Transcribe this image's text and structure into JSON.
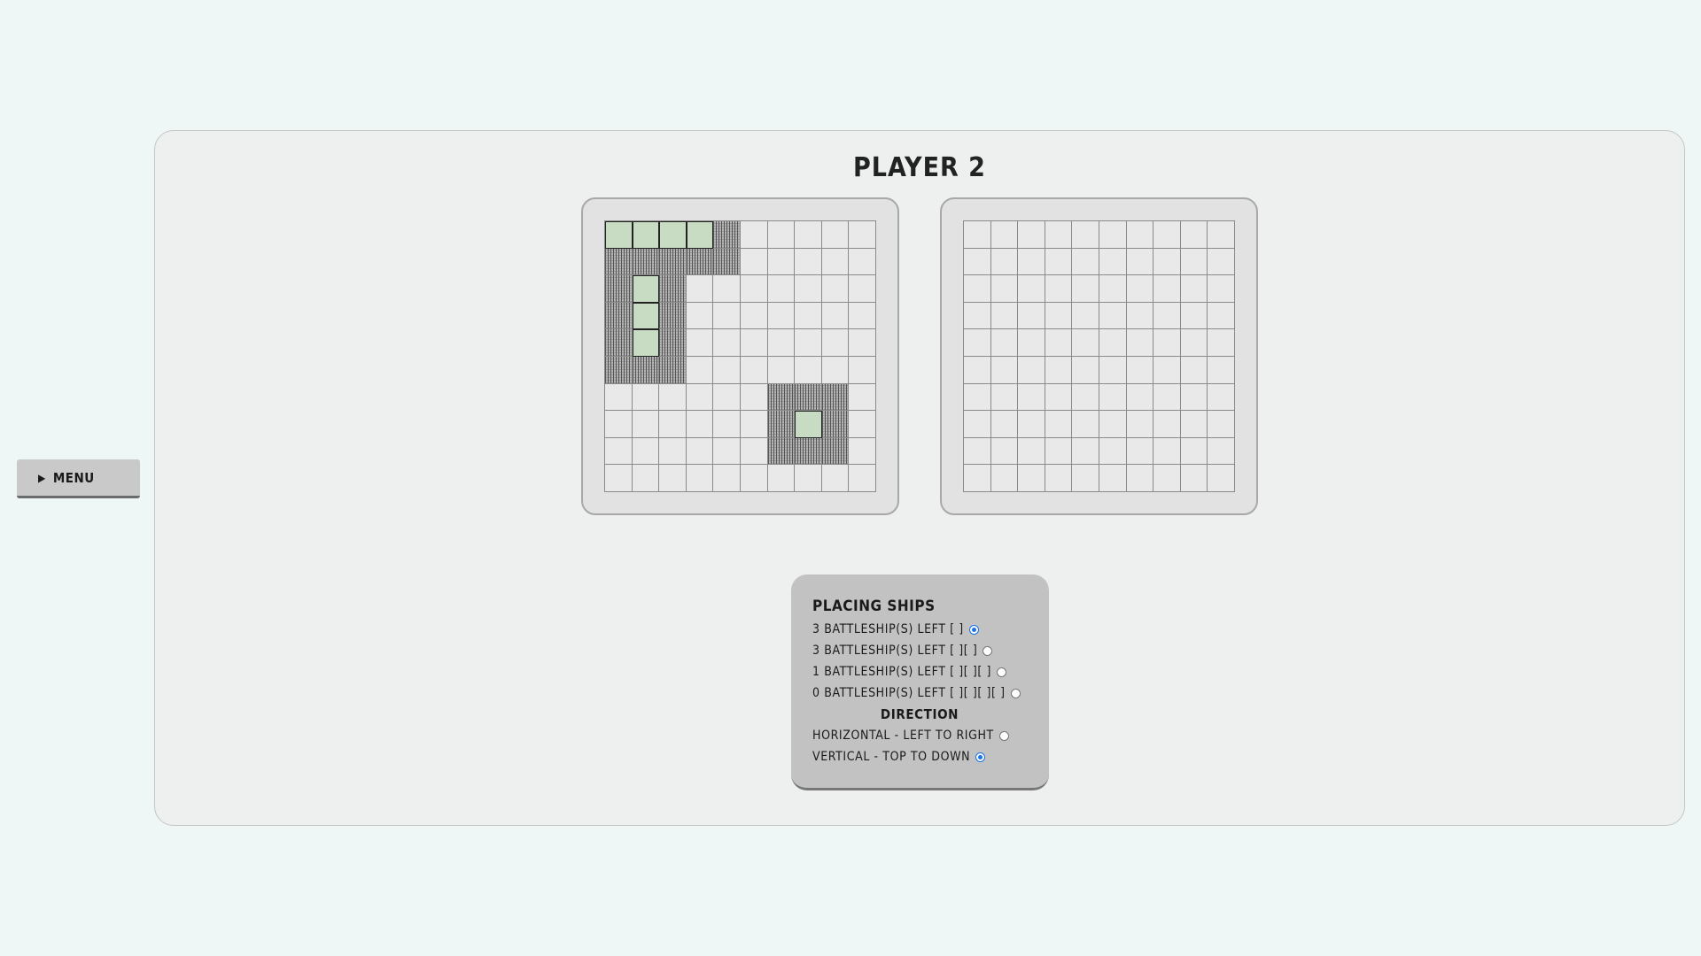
{
  "menu": {
    "label": "MENU",
    "icon": "play-triangle-icon"
  },
  "player_title": "PLAYER 2",
  "colors": {
    "ship": "#c7dcc3",
    "blocked": "#b5b5b5",
    "empty": "#e9e9e9",
    "accent": "#1a73e8"
  },
  "boards": {
    "own": {
      "ships": [
        [
          0,
          0
        ],
        [
          0,
          1
        ],
        [
          0,
          2
        ],
        [
          0,
          3
        ],
        [
          2,
          1
        ],
        [
          3,
          1
        ],
        [
          4,
          1
        ],
        [
          7,
          7
        ]
      ],
      "blocked": [
        [
          0,
          4
        ],
        [
          1,
          0
        ],
        [
          1,
          1
        ],
        [
          1,
          2
        ],
        [
          1,
          3
        ],
        [
          1,
          4
        ],
        [
          2,
          0
        ],
        [
          2,
          2
        ],
        [
          3,
          0
        ],
        [
          3,
          2
        ],
        [
          4,
          0
        ],
        [
          4,
          2
        ],
        [
          5,
          0
        ],
        [
          5,
          1
        ],
        [
          5,
          2
        ],
        [
          6,
          6
        ],
        [
          6,
          7
        ],
        [
          6,
          8
        ],
        [
          7,
          6
        ],
        [
          7,
          8
        ],
        [
          8,
          6
        ],
        [
          8,
          7
        ],
        [
          8,
          8
        ]
      ]
    },
    "enemy": {
      "ships": [],
      "blocked": []
    }
  },
  "placing": {
    "title": "PLACING SHIPS",
    "options": [
      {
        "label": "3 BATTLESHIP(S) LEFT [ ]",
        "checked": true
      },
      {
        "label": "3 BATTLESHIP(S) LEFT [ ][ ]",
        "checked": false
      },
      {
        "label": "1 BATTLESHIP(S) LEFT [ ][ ][ ]",
        "checked": false
      },
      {
        "label": "0 BATTLESHIP(S) LEFT [ ][ ][ ][ ]",
        "checked": false
      }
    ],
    "direction_title": "DIRECTION",
    "directions": [
      {
        "label": "HORIZONTAL - LEFT TO RIGHT",
        "checked": false
      },
      {
        "label": "VERTICAL - TOP TO DOWN",
        "checked": true
      }
    ]
  }
}
